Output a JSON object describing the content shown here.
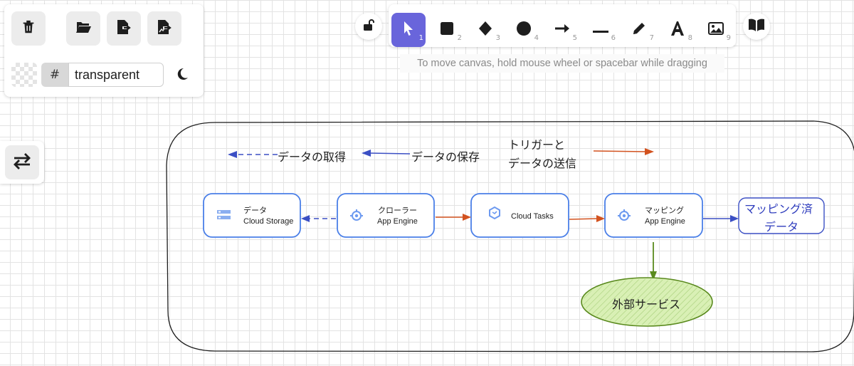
{
  "left_panel": {
    "background_value": "transparent",
    "hash_symbol": "#",
    "icons": [
      "trash-icon",
      "folder-open-icon",
      "export-icon",
      "export-image-icon",
      "moon-icon"
    ]
  },
  "side_button": {
    "icon": "swap-icon"
  },
  "toolbar": {
    "lock_icon": "unlock-icon",
    "library_icon": "book-icon",
    "tools": [
      {
        "name": "selection",
        "key": "1",
        "icon": "pointer-icon",
        "active": true
      },
      {
        "name": "rectangle",
        "key": "2",
        "icon": "square-icon"
      },
      {
        "name": "diamond",
        "key": "3",
        "icon": "diamond-icon"
      },
      {
        "name": "ellipse",
        "key": "4",
        "icon": "circle-icon"
      },
      {
        "name": "arrow",
        "key": "5",
        "icon": "arrow-icon"
      },
      {
        "name": "line",
        "key": "6",
        "icon": "line-icon"
      },
      {
        "name": "draw",
        "key": "7",
        "icon": "pencil-icon"
      },
      {
        "name": "text",
        "key": "8",
        "icon": "text-icon"
      },
      {
        "name": "image",
        "key": "9",
        "icon": "image-icon"
      }
    ],
    "accent": "#6965db"
  },
  "hint": "To move canvas, hold mouse wheel or spacebar while dragging",
  "diagram": {
    "legend": {
      "fetch": "データの取得",
      "save": "データの保存",
      "trigger_line1": "トリガーと",
      "trigger_line2": "データの送信"
    },
    "nodes": {
      "storage": {
        "line1": "データ",
        "line2": "Cloud Storage"
      },
      "crawler": {
        "line1": "クローラー",
        "line2": "App Engine"
      },
      "tasks": {
        "line1": "Cloud Tasks"
      },
      "mapping": {
        "line1": "マッピング",
        "line2": "App Engine"
      },
      "mapped": {
        "line1": "マッピング済",
        "line2": "データ"
      },
      "external": {
        "line1": "外部サービス"
      }
    },
    "colors": {
      "node_border": "#4a7fe8",
      "fetch_arrow": "#3b4fc4",
      "trigger_arrow": "#d2521f",
      "external_arrow": "#5a8a1e",
      "external_fill": "#d9f0b5",
      "mapped_text": "#2f3dbd"
    }
  }
}
